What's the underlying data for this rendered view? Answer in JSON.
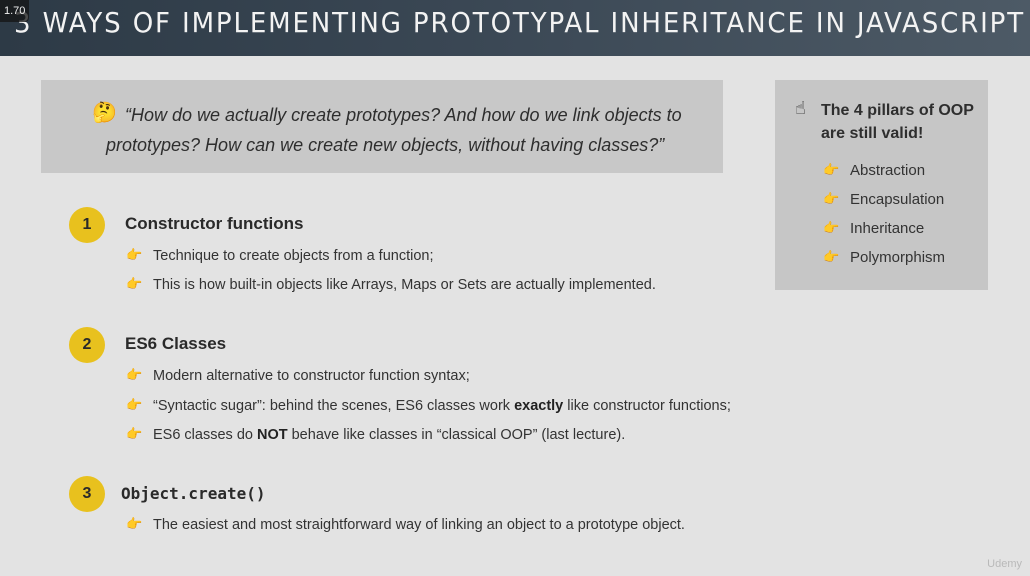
{
  "header": {
    "title": "3 WAYS OF IMPLEMENTING PROTOTYPAL INHERITANCE IN JAVASCRIPT",
    "speed": "1.70"
  },
  "quote": {
    "icon": "thinking-face-emoji",
    "line1": "“How do we actually create prototypes? And how do we link objects to",
    "line2": "prototypes? How can we create new objects, without having classes?”"
  },
  "pillars": {
    "icon": "pointing-up-emoji",
    "title_line1": "The 4 pillars of OOP",
    "title_line2": "are still valid!",
    "items": [
      "Abstraction",
      "Encapsulation",
      "Inheritance",
      "Polymorphism"
    ]
  },
  "sections": [
    {
      "number": "1",
      "title": "Constructor functions",
      "bullets": [
        "Technique to create objects from a function;",
        "This is how built-in objects like Arrays, Maps or Sets are actually implemented."
      ]
    },
    {
      "number": "2",
      "title": "ES6 Classes",
      "bullets": [
        "Modern alternative to constructor function syntax;",
        {
          "pre": "“Syntactic sugar”: behind the scenes, ES6 classes work ",
          "bold": "exactly",
          "post": " like constructor functions;"
        },
        {
          "pre": "ES6 classes do ",
          "bold": "NOT",
          "post": " behave like classes in “classical OOP” (last lecture)."
        }
      ]
    },
    {
      "number": "3",
      "title": "Object.create()",
      "bullets": [
        "The easiest and most straightforward way of linking an object to a prototype object."
      ]
    }
  ],
  "watermark": "Udemy",
  "colors": {
    "title_bar": "#3a4754",
    "badge": "#e8c11e",
    "background": "#e3e3e3",
    "box": "#c8c8c8"
  }
}
